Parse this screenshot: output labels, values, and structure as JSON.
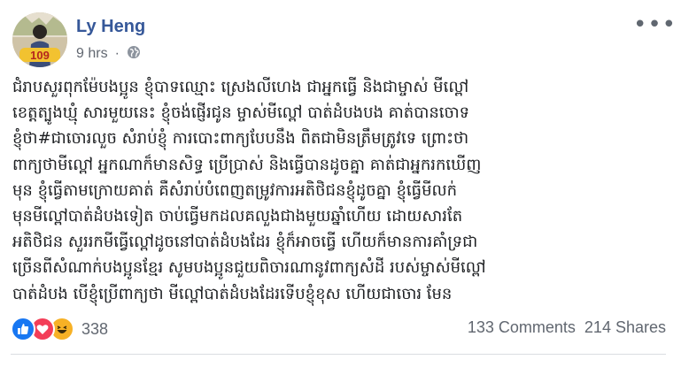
{
  "post": {
    "author": {
      "name": "Ly Heng",
      "avatar_badge": "109"
    },
    "time": "9 hrs",
    "audience_icon": "globe-icon",
    "more_icon": "more-options-icon",
    "more_label": "•••",
    "text_lines": [
      "ជំរាបសួរពុកម៉ែបងប្អូន ខ្ញុំបាទឈ្មោះ ស្រេងលីហេង ជាអ្នកធ្វើ និងជាម្ចាស់ មីល្ពៅ",
      "ខេត្តត្បូងឃ្មុំ សារមួយនេះ ខ្ញុំចង់ផ្ញើរជូន ម្ចាស់មីល្ពៅ បាត់ដំបងបង គាត់បានចោទ",
      "ខ្ញុំថា#ជាចោរលួច សំរាប់ខ្ញុំ ការបោះពាក្យបែបនឹង ពិតជាមិនត្រឹមត្រូវទេ ព្រោះថា",
      "ពាក្យថាមីល្ពៅ អ្នកណាក៏មានសិទ្ធ ប្រើប្រាស់ និងធ្វើបានដូចគ្នា គាត់ជាអ្នករកឃើញ",
      "មុន ខ្ញុំធ្វើតាមក្រោយគាត់ គឺសំរាប់បំពេញតម្រូវការអតិថិជនខ្ញុំដូចគ្នា ខ្ញុំធ្វើមីលក់",
      "មុនមីល្ពៅបាត់ដំបងទៀត ចាប់ធ្វើមកដលគលួងជាងមួយឆ្នាំហើយ ដោយសារតែ",
      "អតិថិជន សួររកមីធ្វើល្ពៅដូចនៅបាត់ដំបងដែរ ខ្ញុំក៏អាចធ្វើ ហើយក៏មានការគាំទ្រជា",
      "ច្រើនពីសំណាក់បងប្អូនខ្មែរ សូមបងប្អូនជួយពិចារណានូវពាក្យសំដី របស់ម្ចាស់មីល្ពៅ",
      "បាត់ដំបង បើខ្ញុំប្រើពាក្យថា មីល្ពៅបាត់ដំបងដែរទើបខ្ញុំខុស ហើយជាចោរ មែន"
    ],
    "reactions": {
      "icons": [
        "like-reaction-icon",
        "love-reaction-icon",
        "haha-reaction-icon"
      ],
      "colors": {
        "like": "#1877f2",
        "love": "#f33e58",
        "haha": "#f7b125"
      },
      "count": "338"
    },
    "comments": "133 Comments",
    "shares": "214 Shares"
  },
  "colors": {
    "author": "#365899",
    "meta": "#616770",
    "text": "#1c1e21",
    "divider": "#dadde1"
  }
}
